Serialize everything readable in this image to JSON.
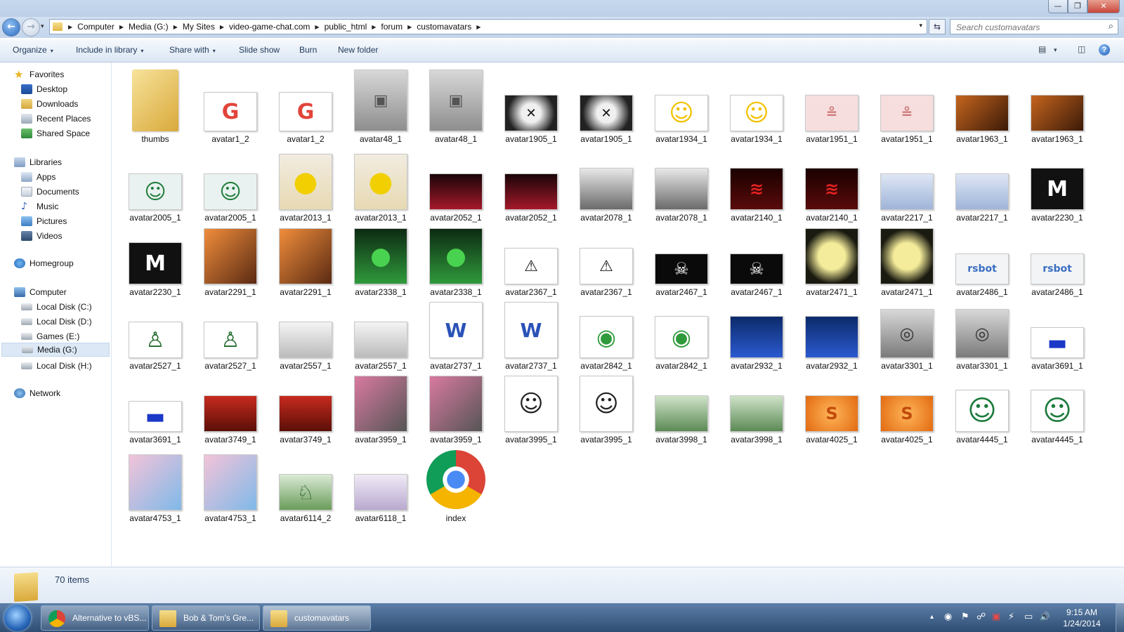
{
  "window": {
    "controls": {
      "minimize": "—",
      "maximize": "❐",
      "close": "✕"
    }
  },
  "nav": {
    "back": "←",
    "forward": "→",
    "dropdown": "▾"
  },
  "address": {
    "crumbs": [
      "Computer",
      "Media (G:)",
      "My Sites",
      "video-game-chat.com",
      "public_html",
      "forum",
      "customavatars"
    ],
    "separator": "▶",
    "dropdown": "▾",
    "refresh": "⇆"
  },
  "search": {
    "placeholder": "Search customavatars",
    "icon": "⌕"
  },
  "toolbar": {
    "organize": "Organize",
    "include": "Include in library",
    "share": "Share with",
    "slideshow": "Slide show",
    "burn": "Burn",
    "new_folder": "New folder",
    "caret": "▾",
    "views": "▤",
    "views_caret": "▾",
    "pane": "◫",
    "help": "?"
  },
  "sidebar": {
    "favorites": {
      "title": "Favorites",
      "items": [
        "Desktop",
        "Downloads",
        "Recent Places",
        "Shared Space"
      ]
    },
    "libraries": {
      "title": "Libraries",
      "items": [
        "Apps",
        "Documents",
        "Music",
        "Pictures",
        "Videos"
      ]
    },
    "homegroup": "Homegroup",
    "computer": {
      "title": "Computer",
      "items": [
        "Local Disk (C:)",
        "Local Disk (D:)",
        "Games (E:)",
        "Media (G:)",
        "Local Disk (H:)"
      ]
    },
    "network": "Network",
    "selected": "Media (G:)"
  },
  "files": [
    {
      "name": "thumbs",
      "icon": "folder"
    },
    {
      "name": "avatar1_2",
      "icon": "google-spider"
    },
    {
      "name": "avatar1_2",
      "icon": "google-spider"
    },
    {
      "name": "avatar48_1",
      "icon": "complaint-department"
    },
    {
      "name": "avatar48_1",
      "icon": "complaint-department"
    },
    {
      "name": "avatar1905_1",
      "icon": "xd-face"
    },
    {
      "name": "avatar1905_1",
      "icon": "xd-face"
    },
    {
      "name": "avatar1934_1",
      "icon": "homer"
    },
    {
      "name": "avatar1934_1",
      "icon": "homer"
    },
    {
      "name": "avatar1951_1",
      "icon": "cat"
    },
    {
      "name": "avatar1951_1",
      "icon": "cat"
    },
    {
      "name": "avatar1963_1",
      "icon": "tiger"
    },
    {
      "name": "avatar1963_1",
      "icon": "tiger"
    },
    {
      "name": "avatar2005_1",
      "icon": "kyle"
    },
    {
      "name": "avatar2005_1",
      "icon": "kyle"
    },
    {
      "name": "avatar2013_1",
      "icon": "grenade-chick"
    },
    {
      "name": "avatar2013_1",
      "icon": "grenade-chick"
    },
    {
      "name": "avatar2052_1",
      "icon": "red-hair"
    },
    {
      "name": "avatar2052_1",
      "icon": "red-hair"
    },
    {
      "name": "avatar2078_1",
      "icon": "anime-face"
    },
    {
      "name": "avatar2078_1",
      "icon": "anime-face"
    },
    {
      "name": "avatar2140_1",
      "icon": "graffiti"
    },
    {
      "name": "avatar2140_1",
      "icon": "graffiti"
    },
    {
      "name": "avatar2217_1",
      "icon": "loveless"
    },
    {
      "name": "avatar2217_1",
      "icon": "loveless"
    },
    {
      "name": "avatar2230_1",
      "icon": "mtv"
    },
    {
      "name": "avatar2230_1",
      "icon": "mtv"
    },
    {
      "name": "avatar2291_1",
      "icon": "sunglasses"
    },
    {
      "name": "avatar2291_1",
      "icon": "sunglasses"
    },
    {
      "name": "avatar2338_1",
      "icon": "green-bear"
    },
    {
      "name": "avatar2338_1",
      "icon": "green-bear"
    },
    {
      "name": "avatar2367_1",
      "icon": "warning"
    },
    {
      "name": "avatar2367_1",
      "icon": "warning"
    },
    {
      "name": "avatar2467_1",
      "icon": "skull-tape"
    },
    {
      "name": "avatar2467_1",
      "icon": "skull-tape"
    },
    {
      "name": "avatar2471_1",
      "icon": "yellow-skull"
    },
    {
      "name": "avatar2471_1",
      "icon": "yellow-skull"
    },
    {
      "name": "avatar2486_1",
      "icon": "rsbot"
    },
    {
      "name": "avatar2486_1",
      "icon": "rsbot"
    },
    {
      "name": "avatar2527_1",
      "icon": "pixel-char"
    },
    {
      "name": "avatar2527_1",
      "icon": "pixel-char"
    },
    {
      "name": "avatar2557_1",
      "icon": "sketch"
    },
    {
      "name": "avatar2557_1",
      "icon": "sketch"
    },
    {
      "name": "avatar2737_1",
      "icon": "w-cap"
    },
    {
      "name": "avatar2737_1",
      "icon": "w-cap"
    },
    {
      "name": "avatar2842_1",
      "icon": "green-river"
    },
    {
      "name": "avatar2842_1",
      "icon": "green-river"
    },
    {
      "name": "avatar2932_1",
      "icon": "blue-wave"
    },
    {
      "name": "avatar2932_1",
      "icon": "blue-wave"
    },
    {
      "name": "avatar3301_1",
      "icon": "magnet"
    },
    {
      "name": "avatar3301_1",
      "icon": "magnet"
    },
    {
      "name": "avatar3691_1",
      "icon": "blue-car"
    },
    {
      "name": "avatar3691_1",
      "icon": "blue-car"
    },
    {
      "name": "avatar3749_1",
      "icon": "slut"
    },
    {
      "name": "avatar3749_1",
      "icon": "slut"
    },
    {
      "name": "avatar3959_1",
      "icon": "headphones"
    },
    {
      "name": "avatar3959_1",
      "icon": "headphones"
    },
    {
      "name": "avatar3995_1",
      "icon": "cartoon-guy"
    },
    {
      "name": "avatar3995_1",
      "icon": "cartoon-guy"
    },
    {
      "name": "avatar3998_1",
      "icon": "zombie"
    },
    {
      "name": "avatar3998_1",
      "icon": "zombie"
    },
    {
      "name": "avatar4025_1",
      "icon": "orange-s"
    },
    {
      "name": "avatar4025_1",
      "icon": "orange-s"
    },
    {
      "name": "avatar4445_1",
      "icon": "joker"
    },
    {
      "name": "avatar4445_1",
      "icon": "joker"
    },
    {
      "name": "avatar4753_1",
      "icon": "girl"
    },
    {
      "name": "avatar4753_1",
      "icon": "girl"
    },
    {
      "name": "avatar6114_2",
      "icon": "link"
    },
    {
      "name": "avatar6118_1",
      "icon": "anime-small"
    },
    {
      "name": "index",
      "icon": "chrome"
    }
  ],
  "status": {
    "count": "70 items"
  },
  "taskbar": {
    "tasks": [
      {
        "label": "Alternative to vBS...",
        "icon": "chrome-icon"
      },
      {
        "label": "Bob & Tom's Gre...",
        "icon": "folder-icon"
      },
      {
        "label": "customavatars",
        "icon": "folder-icon"
      }
    ],
    "tray": {
      "up": "▴",
      "gauge": "◉",
      "flag": "⚑",
      "network": "☍",
      "red": "▣",
      "usb": "⚡",
      "display": "▭",
      "volume": "🔊"
    },
    "clock": {
      "time": "9:15 AM",
      "date": "1/24/2014"
    }
  }
}
